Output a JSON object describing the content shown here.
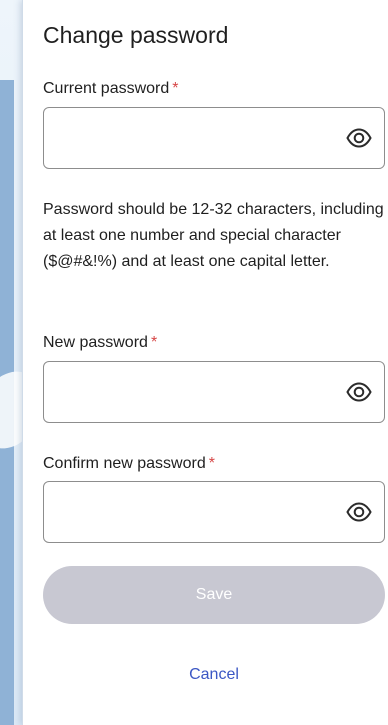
{
  "dialog": {
    "title": "Change password"
  },
  "fields": {
    "current": {
      "label": "Current password",
      "required_mark": "*",
      "value": "",
      "placeholder": "",
      "toggle_icon": "eye-icon"
    },
    "new": {
      "label": "New password",
      "required_mark": "*",
      "value": "",
      "placeholder": "",
      "toggle_icon": "eye-icon"
    },
    "confirm": {
      "label": "Confirm new password",
      "required_mark": "*",
      "value": "",
      "placeholder": "",
      "toggle_icon": "eye-icon"
    }
  },
  "hint": "Password should be 12-32 characters, including at least one number and special character ($@#&!%) and at least one capital letter.",
  "actions": {
    "save_label": "Save",
    "cancel_label": "Cancel"
  },
  "colors": {
    "required": "#d64545",
    "save_disabled_bg": "#c8c8d2",
    "link": "#3b57c4"
  }
}
